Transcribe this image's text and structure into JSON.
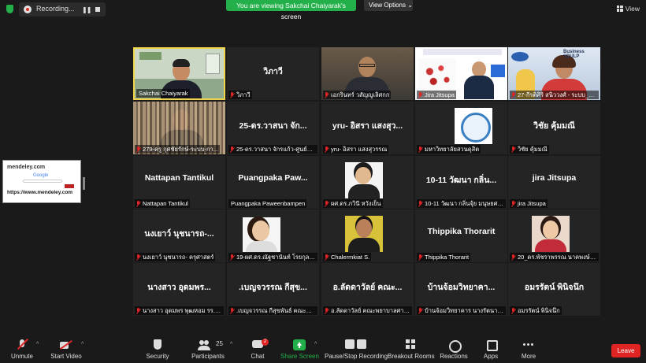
{
  "top": {
    "recording": "Recording...",
    "viewing_banner": "You are viewing Sakchai Chaiyarak's screen",
    "view_options": "View Options",
    "view_label": "View"
  },
  "thumbnail": {
    "site": "mendeley.com",
    "search_engine": "Google",
    "url": "https://www.mendeley.com"
  },
  "tiles": [
    {
      "big": "",
      "name": "Sakchai Chaiyarak",
      "muted": false
    },
    {
      "big": "วิภาวี",
      "name": "วิภาวี",
      "muted": true
    },
    {
      "big": "",
      "name": "เอกรินทร์ วสัญญูเลิศกก",
      "muted": true
    },
    {
      "big": "",
      "name": "Jira Jitsupa",
      "muted": true
    },
    {
      "big": "",
      "name": "27-กีรติศิริ สนิววงศ์ - ระบบ_กำ...",
      "muted": true
    },
    {
      "big": "",
      "name": "279-ครู กุศชัยรักษ์-ระบบ-กา...",
      "muted": true
    },
    {
      "big": "25-ดร.วาสนา จัก...",
      "name": "25-ดร.วาสนา จักรแก้ว-ศูนย์ก้าป...",
      "muted": true
    },
    {
      "big": "yru- อิสรา แสงสุว...",
      "name": "yru- อิสรา แสงสุวรรณ",
      "muted": true
    },
    {
      "big": "",
      "name": "มหาวิทยาลัยสวนดุสิต",
      "muted": true
    },
    {
      "big": "วิชัย คุ้มมณี",
      "name": "วิชัย คุ้มมณี",
      "muted": true
    },
    {
      "big": "Nattapan Tantikul",
      "name": "Nattapan Tantikul",
      "muted": true
    },
    {
      "big": "Puangpaka  Paw...",
      "name": "Puangpaka Paweenbampen",
      "muted": false
    },
    {
      "big": "",
      "name": "ผศ.ดร.ภวินี หวังเย็น",
      "muted": true
    },
    {
      "big": "10-11 วัฒนา กลิ่น...",
      "name": "10-11 วัฒนา กลิ่นจุ้ย มนุษยศาส...",
      "muted": true
    },
    {
      "big": "jira Jitsupa",
      "name": "jira Jitsupa",
      "muted": true
    },
    {
      "big": "นงเยาว์ นุชนารถ-...",
      "name": "นงเยาว์ นุชนารถ- ครุศาสตร์",
      "muted": true
    },
    {
      "big": "",
      "name": "19-ผศ.ดร.ณัฐชานันท์ โรยกุล-ม...",
      "muted": true
    },
    {
      "big": "",
      "name": "Chalermkiat S.",
      "muted": true
    },
    {
      "big": "Thippika Thorarit",
      "name": "Thippika Thorarit",
      "muted": true
    },
    {
      "big": "",
      "name": "20_ดร.พัชราพรรณ นาคพงษ์_นิ...",
      "muted": true
    },
    {
      "big": "นางสาว อุดมพร...",
      "name": "นางสาว อุดมพร พุฒหอม รร. ว...",
      "muted": true
    },
    {
      "big": ".เบญจวรรณ กีสุข...",
      "name": ".เบญจวรรณ กีสุขพันธ์ คณะครุศ...",
      "muted": true
    },
    {
      "big": "อ.ลัดดาวัลย์ คณะ...",
      "name": "อ.ลัดดาวัลย์ คณะพยาบาลศาสตร์",
      "muted": true
    },
    {
      "big": "บ้านจ้อมวิทยาคา...",
      "name": "บ้านจ้อมวิทยาคาร นางรัตนาภรณ์...",
      "muted": true
    },
    {
      "big": "อมรรัตน์ พินิจนึก",
      "name": "อมรรัตน์ พินิจนึก",
      "muted": true
    }
  ],
  "toolbar": {
    "unmute": "Unmute",
    "start_video": "Start Video",
    "security": "Security",
    "participants": "Participants",
    "participants_count": "25",
    "chat": "Chat",
    "chat_badge": "2",
    "share_screen": "Share Screen",
    "pause_stop": "Pause/Stop Recording",
    "breakout_rooms": "Breakout Rooms",
    "reactions": "Reactions",
    "apps": "Apps",
    "more": "More",
    "leave": "Leave"
  },
  "colors": {
    "accent_green": "#23b04a",
    "leave_red": "#e02424",
    "active_speaker": "#f0d44a"
  }
}
